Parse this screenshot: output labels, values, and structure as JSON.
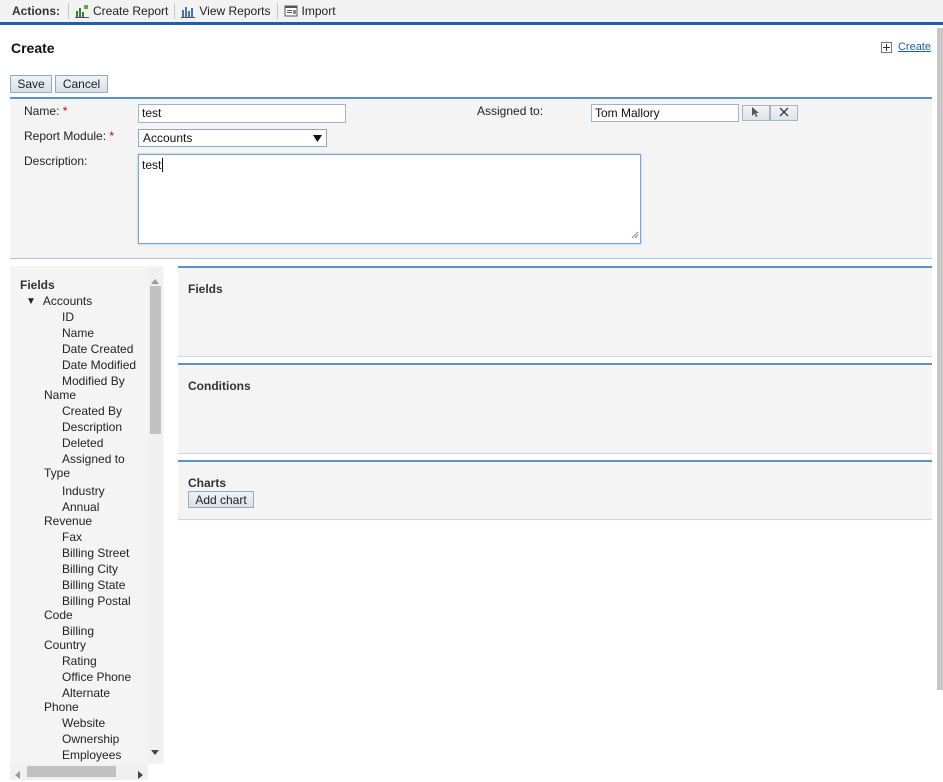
{
  "actions": {
    "label": "Actions:",
    "items": [
      {
        "label": "Create Report",
        "icon": "create-report-icon"
      },
      {
        "label": "View Reports",
        "icon": "view-reports-icon"
      },
      {
        "label": "Import",
        "icon": "import-icon"
      }
    ]
  },
  "page": {
    "title": "Create",
    "create_link": "Create"
  },
  "buttons": {
    "save": "Save",
    "cancel": "Cancel",
    "add_chart": "Add chart"
  },
  "form": {
    "name_label": "Name:",
    "name_value": "test",
    "module_label": "Report Module:",
    "module_value": "Accounts",
    "description_label": "Description:",
    "description_value": "test",
    "assigned_label": "Assigned to:",
    "assigned_value": "Tom Mallory",
    "required_marker": "*"
  },
  "tree": {
    "title": "Fields",
    "root": "Accounts",
    "items": [
      "ID",
      "Name",
      "Date Created",
      "Date Modified",
      "Modified By Name",
      "Created By",
      "Description",
      "Deleted",
      "Assigned to Type",
      "Industry",
      "Annual Revenue",
      "Fax",
      "Billing Street",
      "Billing City",
      "Billing State",
      "Billing Postal Code",
      "Billing Country",
      "Rating",
      "Office Phone",
      "Alternate Phone",
      "Website",
      "Ownership",
      "Employees"
    ]
  },
  "sections": {
    "fields": "Fields",
    "conditions": "Conditions",
    "charts": "Charts"
  },
  "colors": {
    "accent": "#1f5ea8",
    "link": "#1e5aa8",
    "required": "#cc0000"
  }
}
